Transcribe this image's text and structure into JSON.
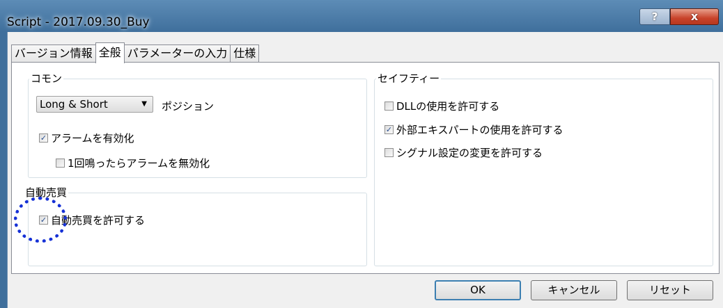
{
  "window": {
    "title": "Script - 2017.09.30_Buy",
    "help_label": "?",
    "close_label": "x"
  },
  "tabs": [
    {
      "label": "バージョン情報"
    },
    {
      "label": "全般"
    },
    {
      "label": "パラメーターの入力"
    },
    {
      "label": "仕様"
    }
  ],
  "common": {
    "group_label": "コモン",
    "position_select_value": "Long & Short",
    "position_label": "ポジション",
    "enable_alarm_label": "アラームを有効化",
    "enable_alarm_checked": "✓",
    "disable_after_one_label": "1回鳴ったらアラームを無効化"
  },
  "auto_trading": {
    "group_label": "自動売買",
    "allow_label": "自動売買を許可する",
    "allow_checked": "✓"
  },
  "safety": {
    "group_label": "セイフティー",
    "allow_dll_label": "DLLの使用を許可する",
    "allow_expert_label": "外部エキスパートの使用を許可する",
    "allow_expert_checked": "✓",
    "allow_signal_label": "シグナル設定の変更を許可する"
  },
  "buttons": {
    "ok": "OK",
    "cancel": "キャンセル",
    "reset": "リセット"
  }
}
